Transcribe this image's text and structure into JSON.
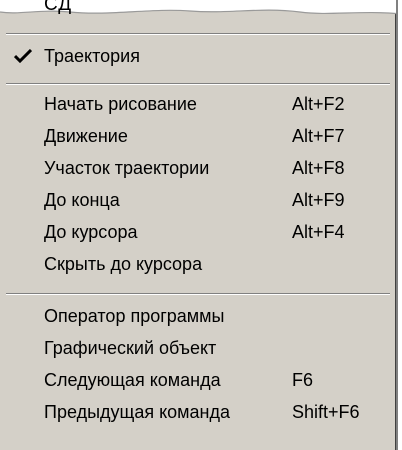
{
  "menu": {
    "top_cut_label": "СД",
    "checked_item": {
      "label": "Траектория",
      "checked": true
    },
    "group1": [
      {
        "label": "Начать рисование",
        "shortcut": "Alt+F2"
      },
      {
        "label": "Движение",
        "shortcut": "Alt+F7"
      },
      {
        "label": "Участок траектории",
        "shortcut": "Alt+F8"
      },
      {
        "label": "До конца",
        "shortcut": "Alt+F9"
      },
      {
        "label": "До курсора",
        "shortcut": "Alt+F4"
      },
      {
        "label": "Скрыть до курсора",
        "shortcut": ""
      }
    ],
    "group2": [
      {
        "label": "Оператор программы",
        "shortcut": ""
      },
      {
        "label": "Графический объект",
        "shortcut": ""
      },
      {
        "label": "Следующая команда",
        "shortcut": "F6"
      },
      {
        "label": "Предыдущая команда",
        "shortcut": "Shift+F6"
      }
    ]
  },
  "colors": {
    "menu_bg": "#d4d0c8",
    "text": "#000000",
    "shadow": "#808080"
  }
}
